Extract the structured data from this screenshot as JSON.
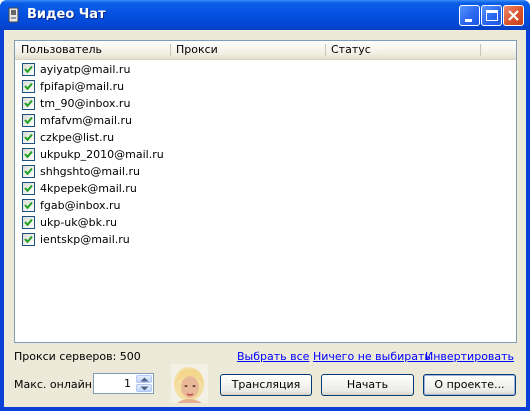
{
  "window": {
    "title": "Видео Чат"
  },
  "listview": {
    "columns": [
      "Пользователь",
      "Прокси",
      "Статус"
    ],
    "rows": [
      {
        "user": "ayiyatp@mail.ru",
        "checked": true
      },
      {
        "user": "fpifapi@mail.ru",
        "checked": true
      },
      {
        "user": "tm_90@inbox.ru",
        "checked": true
      },
      {
        "user": "mfafvm@mail.ru",
        "checked": true
      },
      {
        "user": "czkpe@list.ru",
        "checked": true
      },
      {
        "user": "ukpukp_2010@mail.ru",
        "checked": true
      },
      {
        "user": "shhgshto@mail.ru",
        "checked": true
      },
      {
        "user": "4kpepek@mail.ru",
        "checked": true
      },
      {
        "user": "fgab@inbox.ru",
        "checked": true
      },
      {
        "user": "ukp-uk@bk.ru",
        "checked": true
      },
      {
        "user": "ientskp@mail.ru",
        "checked": true
      }
    ]
  },
  "footer": {
    "proxy_count": "Прокси серверов: 500",
    "select_all": "Выбрать все",
    "select_none": "Ничего не выбирать",
    "invert": "Инвертировать",
    "max_online_label": "Макс. онлайн",
    "max_online_value": "1",
    "broadcast_button": "Трансляция",
    "start_button": "Начать",
    "about_button": "О проекте..."
  },
  "colors": {
    "link": "#0000ff",
    "titlebar": "#0552e0",
    "face": "#ece9d8",
    "checkmark": "#21a121"
  },
  "icons": [
    "app-icon",
    "minimize-icon",
    "maximize-icon",
    "close-icon",
    "checkmark-icon",
    "spin-up-icon",
    "spin-down-icon"
  ]
}
